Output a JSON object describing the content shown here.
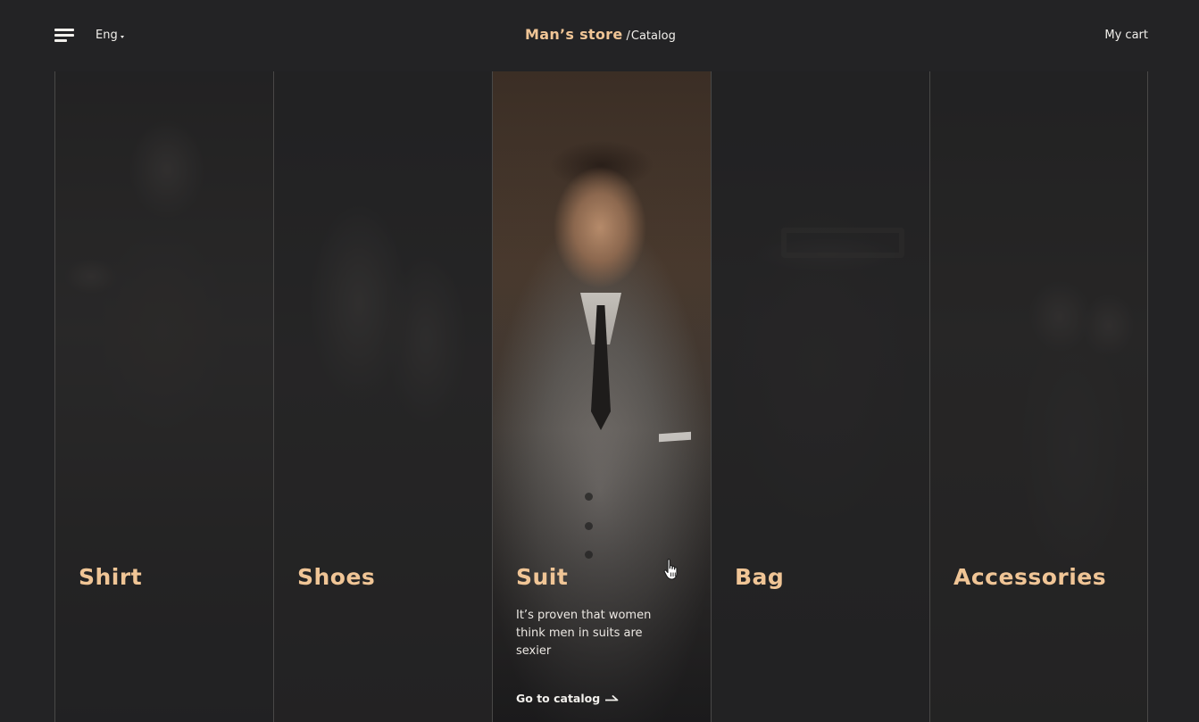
{
  "header": {
    "menu_icon": "hamburger-menu-icon",
    "language": {
      "label": "Eng",
      "icon": "caret-down-icon"
    },
    "brand": {
      "name": "Man’s store",
      "separator": "/",
      "crumb": "Catalog"
    },
    "cart_label": "My cart"
  },
  "categories": [
    {
      "title": "Shirt"
    },
    {
      "title": "Shoes"
    },
    {
      "title": "Suit",
      "active": true,
      "description": "It’s proven that women think men in suits are sexier",
      "link_label": "Go to catalog",
      "link_icon": "arrow-right-icon"
    },
    {
      "title": "Bag"
    },
    {
      "title": "Accessories"
    }
  ],
  "colors": {
    "background": "#232325",
    "accent": "#f0c596",
    "text": "#f2f0ec"
  },
  "cursor": {
    "icon": "hand-pointer-icon"
  }
}
